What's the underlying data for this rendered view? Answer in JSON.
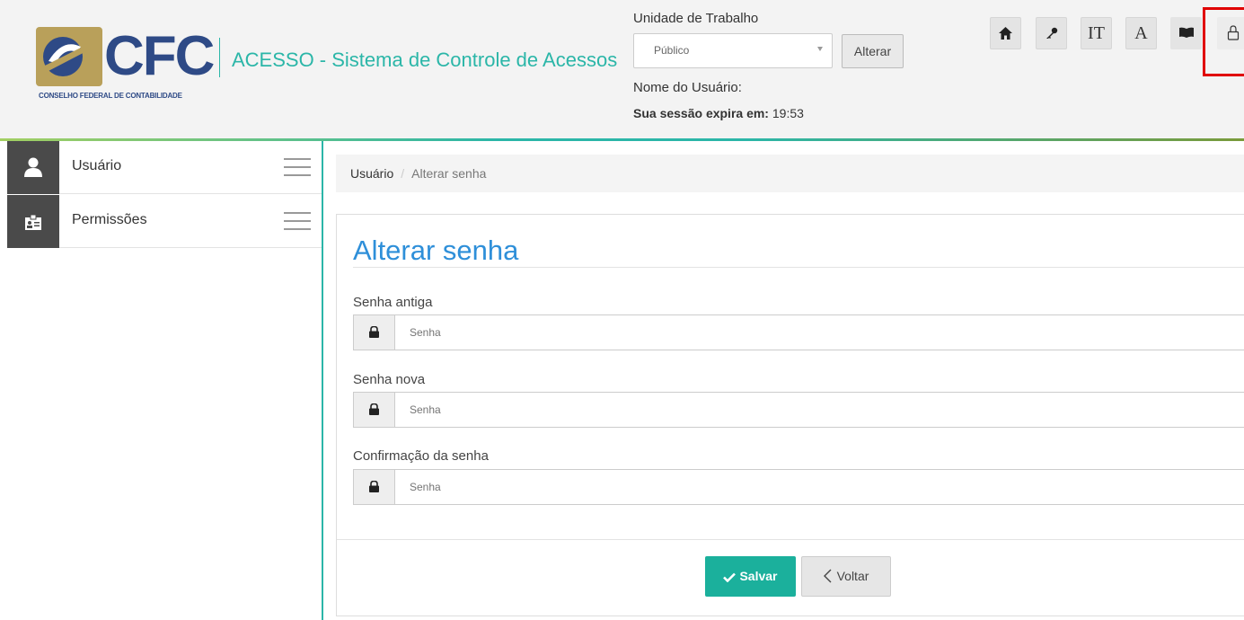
{
  "header": {
    "logo_text": "CFC",
    "logo_subtitle": "CONSELHO FEDERAL DE CONTABILIDADE",
    "app_title": "ACESSO - Sistema de Controle de Acessos",
    "unit_label": "Unidade de Trabalho",
    "unit_select_value": "Público",
    "change_button": "Alterar",
    "user_label": "Nome do Usuário:",
    "session_label": "Sua sessão expira em:",
    "session_time": "19:53",
    "tools": [
      {
        "icon": "home-icon"
      },
      {
        "icon": "key-icon"
      },
      {
        "icon": "text-size-icon",
        "text": "IT"
      },
      {
        "icon": "font-icon",
        "text": "A"
      },
      {
        "icon": "book-icon"
      },
      {
        "icon": "logout-lock-icon"
      }
    ]
  },
  "sidebar": {
    "items": [
      {
        "label": "Usuário",
        "icon": "user-icon"
      },
      {
        "label": "Permissões",
        "icon": "id-card-icon"
      }
    ]
  },
  "breadcrumb": {
    "parent": "Usuário",
    "separator": "/",
    "current": "Alterar senha"
  },
  "form": {
    "title": "Alterar senha",
    "fields": [
      {
        "label": "Senha antiga",
        "placeholder": "Senha"
      },
      {
        "label": "Senha nova",
        "placeholder": "Senha"
      },
      {
        "label": "Confirmação da senha",
        "placeholder": "Senha"
      }
    ],
    "save_button": "Salvar",
    "back_button": "Voltar"
  },
  "colors": {
    "accent_teal": "#2bb6a8",
    "brand_blue": "#2e4a86",
    "title_blue": "#2e8fd9",
    "save_green": "#1bb09c",
    "highlight_red": "#e00000"
  }
}
